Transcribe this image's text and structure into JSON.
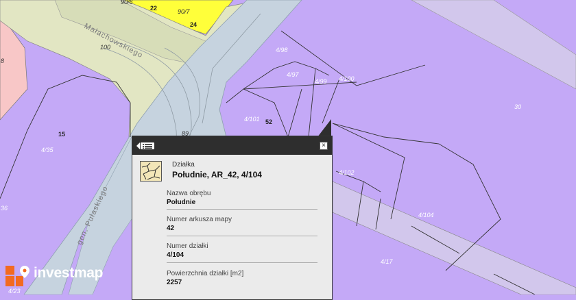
{
  "map": {
    "parcel_labels": [
      "90/6",
      "22",
      "90/7",
      "24",
      "4/98",
      "4/97",
      "4/99",
      "4/100",
      "30",
      "4/101",
      "52",
      "15",
      "4/35",
      "4/102",
      "4/104",
      "4/17",
      "36",
      "4/23",
      "89",
      "100",
      "8"
    ],
    "streets": [
      "Małachowskiego",
      "gen. Pułaskiego"
    ],
    "colors": {
      "parcel": "#c4a9f7",
      "road": "#c6d3df",
      "yellow_zone": "#ffff3a",
      "pink_zone": "#f8c7c7",
      "green_zone": "#e2e6c3"
    }
  },
  "popup": {
    "type_label": "Działka",
    "title": "Południe, AR_42, 4/104",
    "fields": [
      {
        "key": "Nazwa obrębu",
        "value": "Południe"
      },
      {
        "key": "Numer arkusza mapy",
        "value": "42"
      },
      {
        "key": "Numer działki",
        "value": "4/104"
      },
      {
        "key": "Powierzchnia działki [m2]",
        "value": "2257"
      }
    ],
    "close_symbol": "×"
  },
  "logo": {
    "text": "investmap"
  }
}
